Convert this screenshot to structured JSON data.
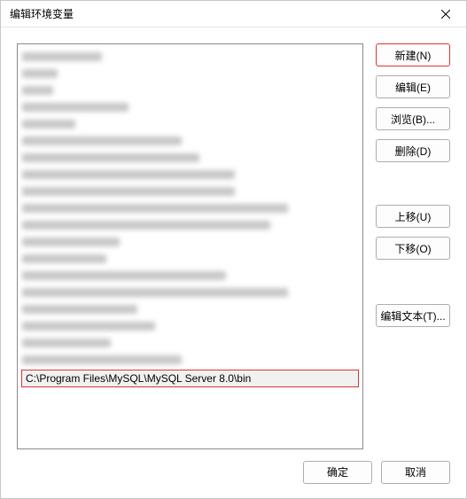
{
  "title": "编辑环境变量",
  "list": {
    "clear_entry": "C:\\Program Files\\MySQL\\MySQL Server 8.0\\bin",
    "blurred_widths": [
      90,
      40,
      35,
      120,
      60,
      180,
      200,
      240,
      240,
      300,
      280,
      110,
      95,
      230,
      300,
      130,
      150,
      100,
      180
    ]
  },
  "buttons": {
    "new": "新建(N)",
    "edit": "编辑(E)",
    "browse": "浏览(B)...",
    "delete": "删除(D)",
    "move_up": "上移(U)",
    "move_down": "下移(O)",
    "edit_text": "编辑文本(T)..."
  },
  "footer": {
    "ok": "确定",
    "cancel": "取消"
  }
}
